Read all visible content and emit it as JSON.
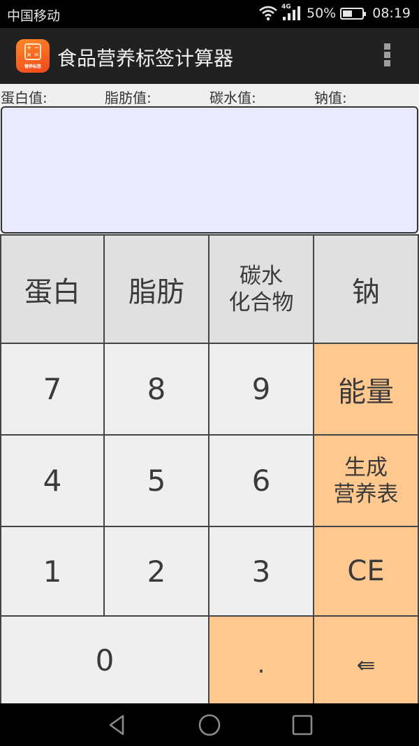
{
  "status_bar": {
    "carrier": "中国移动",
    "network": "4G",
    "battery_percent": "50%",
    "battery_level": 0.5,
    "time": "08:19",
    "icons": [
      "wifi-icon",
      "signal-icon",
      "battery-icon"
    ]
  },
  "action_bar": {
    "app_icon": "calculator-app-icon",
    "app_icon_caption": "营养标签",
    "app_icon_symbols": "+ −\n× =",
    "title": "食品营养标签计算器",
    "overflow_icon": "overflow-menu-icon"
  },
  "value_labels": [
    "蛋白值:",
    "脂肪值:",
    "碳水值:",
    "钠值:"
  ],
  "display": {
    "value": ""
  },
  "keypad": {
    "nutrient_keys": [
      "蛋白",
      "脂肪",
      "碳水\n化合物",
      "钠"
    ],
    "rows": [
      {
        "digits": [
          "7",
          "8",
          "9"
        ],
        "action": "能量"
      },
      {
        "digits": [
          "4",
          "5",
          "6"
        ],
        "action": "生成\n营养表"
      },
      {
        "digits": [
          "1",
          "2",
          "3"
        ],
        "action": "CE"
      }
    ],
    "zero": "0",
    "decimal": ".",
    "backspace": "⇚"
  },
  "colors": {
    "action_key": "#ffc88e",
    "nutrient_key": "#e0e0e0",
    "digit_key": "#efefef",
    "display_bg": "#eaeaff",
    "action_bar": "#212121"
  },
  "nav_bar": {
    "icons": [
      "back-icon",
      "home-icon",
      "recents-icon"
    ]
  }
}
